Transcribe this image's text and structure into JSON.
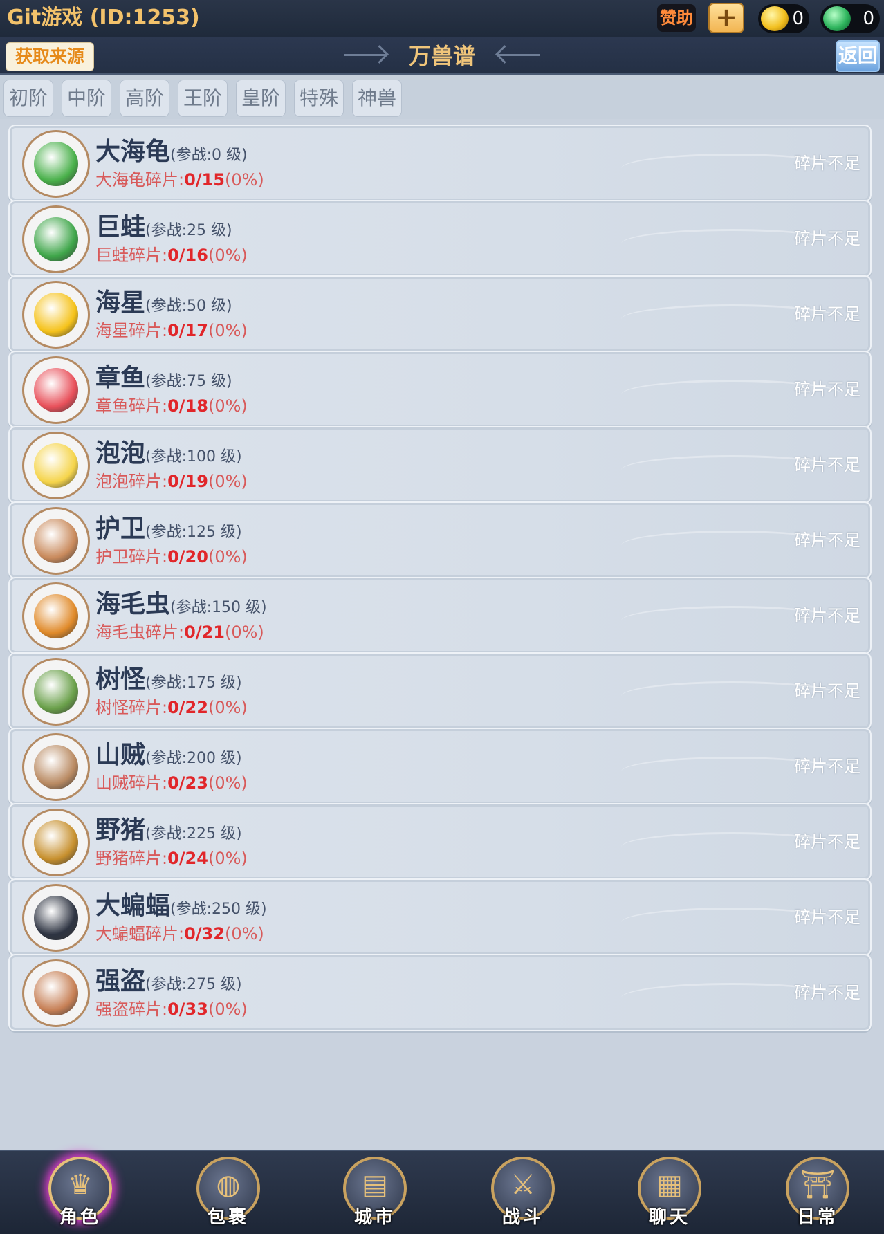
{
  "header": {
    "app_title": "Git游戏 (ID:1253)",
    "sponsor_label": "赞助",
    "plus_label": "+",
    "gold_value": "0",
    "jade_value": "0"
  },
  "titlebar": {
    "source_label": "获取来源",
    "title": "万兽谱",
    "back_label": "返回"
  },
  "tabs": [
    {
      "label": "初阶"
    },
    {
      "label": "中阶"
    },
    {
      "label": "高阶"
    },
    {
      "label": "王阶"
    },
    {
      "label": "皇阶"
    },
    {
      "label": "特殊"
    },
    {
      "label": "神兽"
    }
  ],
  "beasts": [
    {
      "name": "大海龟",
      "level": "(参战:0 级)",
      "shard_label": "大海龟碎片:",
      "shard_count": "0/15",
      "shard_pct": "(0%)",
      "state": "碎片不足",
      "avatar_color": "#49b04a"
    },
    {
      "name": "巨蛙",
      "level": "(参战:25 级)",
      "shard_label": "巨蛙碎片:",
      "shard_count": "0/16",
      "shard_pct": "(0%)",
      "state": "碎片不足",
      "avatar_color": "#3fa64a"
    },
    {
      "name": "海星",
      "level": "(参战:50 级)",
      "shard_label": "海星碎片:",
      "shard_count": "0/17",
      "shard_pct": "(0%)",
      "state": "碎片不足",
      "avatar_color": "#f5c21a"
    },
    {
      "name": "章鱼",
      "level": "(参战:75 级)",
      "shard_label": "章鱼碎片:",
      "shard_count": "0/18",
      "shard_pct": "(0%)",
      "state": "碎片不足",
      "avatar_color": "#e8505a"
    },
    {
      "name": "泡泡",
      "level": "(参战:100 级)",
      "shard_label": "泡泡碎片:",
      "shard_count": "0/19",
      "shard_pct": "(0%)",
      "state": "碎片不足",
      "avatar_color": "#f5d44a"
    },
    {
      "name": "护卫",
      "level": "(参战:125 级)",
      "shard_label": "护卫碎片:",
      "shard_count": "0/20",
      "shard_pct": "(0%)",
      "state": "碎片不足",
      "avatar_color": "#c98a5c"
    },
    {
      "name": "海毛虫",
      "level": "(参战:150 级)",
      "shard_label": "海毛虫碎片:",
      "shard_count": "0/21",
      "shard_pct": "(0%)",
      "state": "碎片不足",
      "avatar_color": "#e08a2a"
    },
    {
      "name": "树怪",
      "level": "(参战:175 级)",
      "shard_label": "树怪碎片:",
      "shard_count": "0/22",
      "shard_pct": "(0%)",
      "state": "碎片不足",
      "avatar_color": "#6aa04a"
    },
    {
      "name": "山贼",
      "level": "(参战:200 级)",
      "shard_label": "山贼碎片:",
      "shard_count": "0/23",
      "shard_pct": "(0%)",
      "state": "碎片不足",
      "avatar_color": "#b98a62"
    },
    {
      "name": "野猪",
      "level": "(参战:225 级)",
      "shard_label": "野猪碎片:",
      "shard_count": "0/24",
      "shard_pct": "(0%)",
      "state": "碎片不足",
      "avatar_color": "#c7902e"
    },
    {
      "name": "大蝙蝠",
      "level": "(参战:250 级)",
      "shard_label": "大蝙蝠碎片:",
      "shard_count": "0/32",
      "shard_pct": "(0%)",
      "state": "碎片不足",
      "avatar_color": "#2e3442"
    },
    {
      "name": "强盗",
      "level": "(参战:275 级)",
      "shard_label": "强盗碎片:",
      "shard_count": "0/33",
      "shard_pct": "(0%)",
      "state": "碎片不足",
      "avatar_color": "#c78056"
    }
  ],
  "bottom_nav": [
    {
      "label": "角色",
      "icon": "character-icon",
      "glyph": "♛"
    },
    {
      "label": "包裹",
      "icon": "bag-icon",
      "glyph": "◍"
    },
    {
      "label": "城市",
      "icon": "city-map-icon",
      "glyph": "▤"
    },
    {
      "label": "战斗",
      "icon": "battle-icon",
      "glyph": "⚔"
    },
    {
      "label": "聊天",
      "icon": "chat-scroll-icon",
      "glyph": "▦"
    },
    {
      "label": "日常",
      "icon": "daily-temple-icon",
      "glyph": "⛩"
    }
  ]
}
